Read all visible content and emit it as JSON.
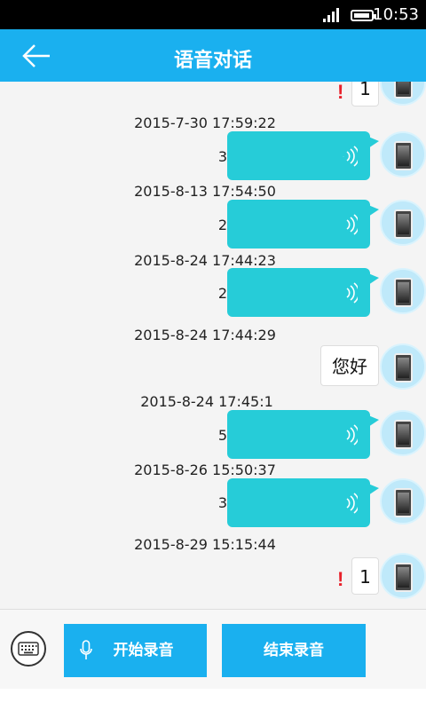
{
  "status": {
    "time": "10:53"
  },
  "header": {
    "title": "语音对话"
  },
  "messages": [
    {
      "type": "text",
      "text": "1",
      "failed": true
    },
    {
      "timestamp": "2015-7-30 17:59:22",
      "type": "voice",
      "duration": "3"
    },
    {
      "timestamp": "2015-8-13 17:54:50",
      "type": "voice",
      "duration": "2"
    },
    {
      "timestamp": "2015-8-24 17:44:23",
      "type": "voice",
      "duration": "2"
    },
    {
      "timestamp": "2015-8-24 17:44:29",
      "type": "text",
      "text": "您好"
    },
    {
      "timestamp": "2015-8-24 17:45:1",
      "type": "voice",
      "duration": "5"
    },
    {
      "timestamp": "2015-8-26 15:50:37",
      "type": "voice",
      "duration": "3"
    },
    {
      "timestamp": "2015-8-29 15:15:44",
      "type": "text",
      "text": "1",
      "failed": true
    }
  ],
  "bottom": {
    "start_label": "开始录音",
    "stop_label": "结束录音"
  },
  "colors": {
    "accent": "#1ab0ef",
    "voice_bubble": "#26ccd8",
    "error": "#e8202a"
  }
}
